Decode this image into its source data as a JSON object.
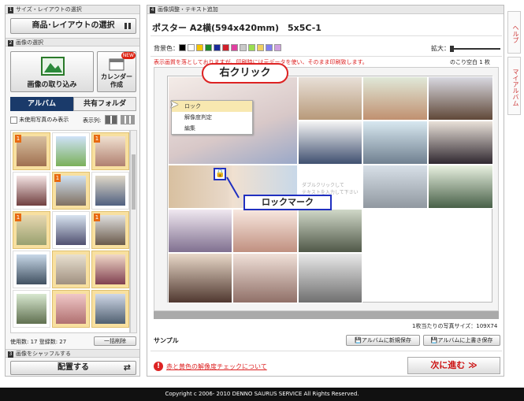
{
  "left": {
    "sec1": {
      "num": "1",
      "title": "サイズ・レイアウトの選択"
    },
    "product_button": "商品･レイアウトの選択",
    "sec2": {
      "num": "2",
      "title": "画像の選択"
    },
    "import_button": "画像の取り込み",
    "calendar_button": "カレンダー作成",
    "calendar_new": "NEW",
    "tabs": [
      "アルバム",
      "共有フォルダ"
    ],
    "unused_only": "未使用写真のみ表示",
    "display_label": "表示列:",
    "thumbs": [
      "1",
      "",
      "1",
      "",
      "1",
      "",
      "1",
      "",
      "1",
      "",
      "",
      ""
    ],
    "usage": "使用数: 17 登録数: 27",
    "bulk_delete": "一括削除",
    "sec3": {
      "num": "3",
      "title": "画像をシャッフルする"
    },
    "place_button": "配置する"
  },
  "main": {
    "sec4": {
      "num": "4",
      "title": "画像調整・テキスト追加"
    },
    "title": "ポスター A2横(594x420mm)　5x5C-1",
    "bg_label": "背景色：",
    "swatches": [
      "#000000",
      "#ffffff",
      "#f5c400",
      "#1a8a2a",
      "#1a2a9a",
      "#d0202a",
      "#e040a0",
      "#c8c8c8",
      "#9adf50",
      "#f0d060",
      "#8080f0",
      "#d0a0e0"
    ],
    "zoom_label": "拡大：",
    "notice": "表示画質を落としておりますが、印刷時には元データを使い、そのまま印刷致します。",
    "remaining": "のこり空白 1 枚",
    "callout": "右クリック",
    "context_menu": [
      "ロック",
      "解像度判定",
      "編集"
    ],
    "lock_mark_label": "ロックマーク",
    "text_placeholder": "ダブルクリックして\nテキストを入力して下さい",
    "sample_label": "サンプル",
    "photo_size": "1枚当たりの写真サイズ：109X74",
    "save_new": "アルバムに新規保存",
    "save_over": "アルバムに上書き保存",
    "warning_link": "赤と黄色の解像度チェックについて",
    "next_button": "次に進む ≫"
  },
  "side_tabs": [
    "ヘルプ",
    "マイアルバム"
  ],
  "footer": "Copyright c 2006- 2010 DENNO SAURUS SERVICE All Rights Reserved."
}
